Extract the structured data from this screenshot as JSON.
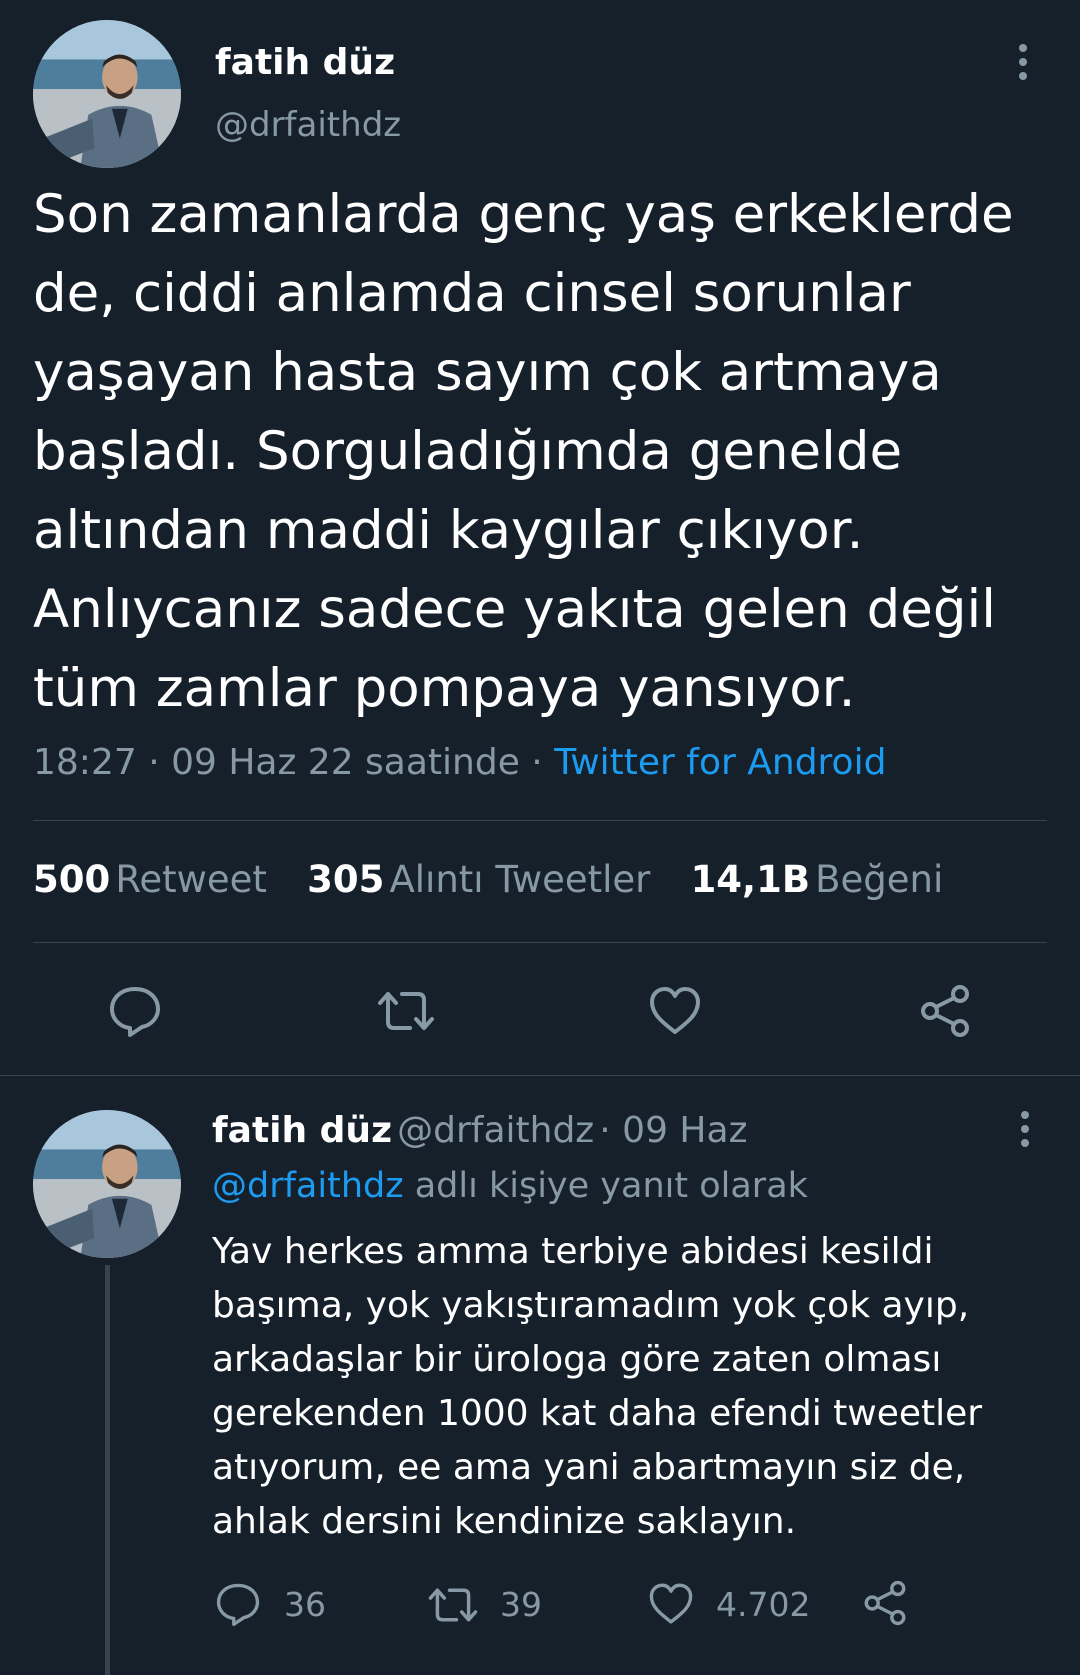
{
  "main_tweet": {
    "author_name": "fatih düz",
    "author_handle": "@drfaithdz",
    "text": "Son zamanlarda genç yaş erkeklerde\nde, ciddi anlamda cinsel sorunlar\nyaşayan hasta sayım çok artmaya\nbaşladı. Sorguladığımda genelde\naltından maddi kaygılar çıkıyor.\nAnlıycanız sadece yakıta gelen değil\ntüm zamlar pompaya yansıyor.",
    "timestamp": "18:27 · 09 Haz 22 saatinde · ",
    "source": "Twitter for Android",
    "stats": {
      "retweets_num": "500",
      "retweets_label": "Retweet",
      "quotes_num": "305",
      "quotes_label": "Alıntı Tweetler",
      "likes_num": "14,1B",
      "likes_label": "Beğeni"
    },
    "icons": [
      "reply-icon",
      "retweet-icon",
      "like-icon",
      "share-icon"
    ]
  },
  "reply": {
    "author_name": "fatih düz",
    "author_handle": "@drfaithdz",
    "date": "· 09 Haz",
    "reply_mention": "@drfaithdz",
    "reply_suffix": " adlı kişiye yanıt olarak",
    "text": "Yav herkes amma terbiye abidesi kesildi\nbaşıma, yok yakıştıramadım yok çok ayıp,\narkadaşlar bir ürologa göre zaten olması\ngerekenden 1000 kat daha efendi tweetler\natıyorum, ee ama yani abartmayın siz de,\nahlak dersini kendinize saklayın.",
    "reply_count": "36",
    "retweet_count": "39",
    "like_count": "4.702"
  },
  "colors": {
    "background": "#15202b",
    "accent": "#1d9bf0",
    "muted": "#8899a6",
    "divider": "#38444d"
  }
}
